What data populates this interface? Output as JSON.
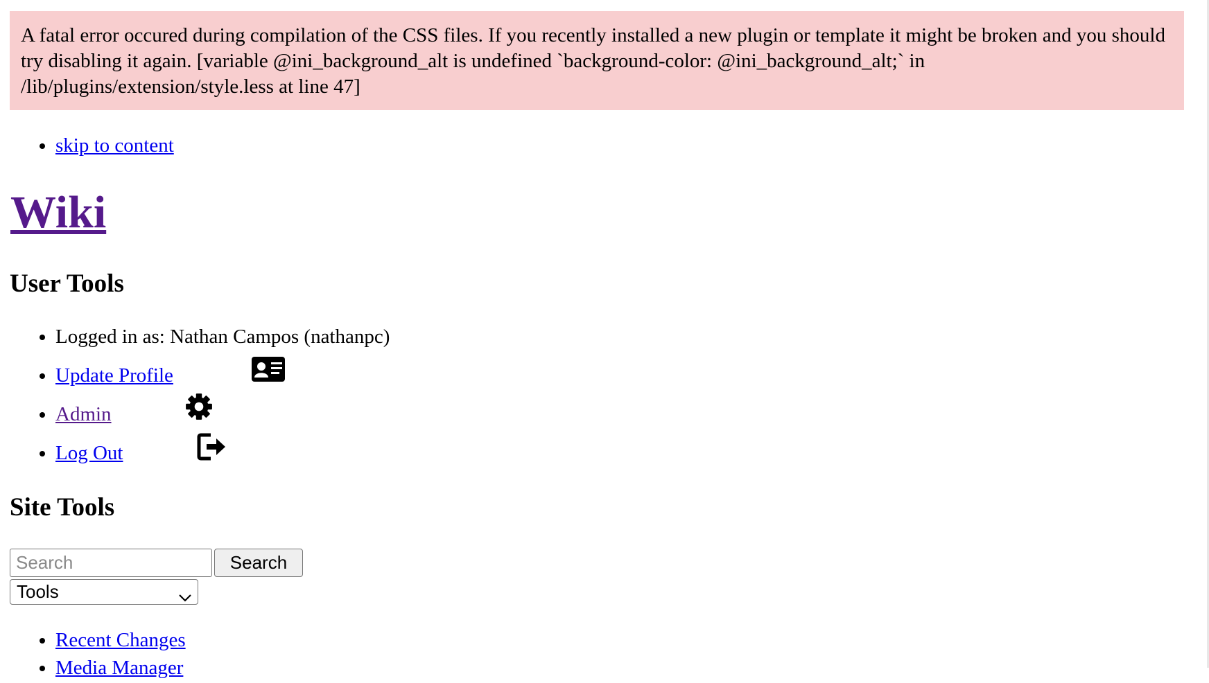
{
  "error": {
    "message": "A fatal error occured during compilation of the CSS files. If you recently installed a new plugin or template it might be broken and you should try disabling it again. [variable @ini_background_alt is undefined `background-color: @ini_background_alt;` in /lib/plugins/extension/style.less at line 47]"
  },
  "skip_link": "skip to content",
  "site_title": "Wiki",
  "user_tools": {
    "heading": "User Tools",
    "logged_in": "Logged in as: Nathan Campos (nathanpc)",
    "update_profile": "Update Profile",
    "admin": "Admin",
    "logout": "Log Out",
    "icons": [
      "id-card-icon",
      "gear-icon",
      "logout-icon"
    ]
  },
  "site_tools": {
    "heading": "Site Tools",
    "search_placeholder": "Search",
    "search_button": "Search",
    "tools_select": "Tools",
    "links": [
      "Recent Changes",
      "Media Manager"
    ]
  }
}
